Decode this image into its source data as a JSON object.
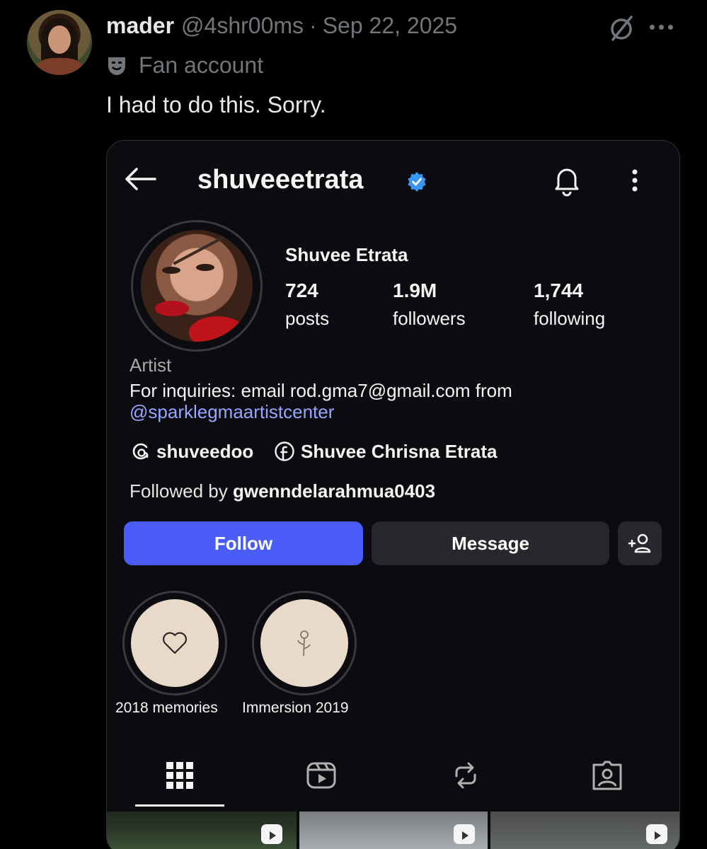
{
  "tweet": {
    "display_name": "mader",
    "handle": "@4shr00ms",
    "separator": "·",
    "date": "Sep 22, 2025",
    "label": "Fan account",
    "text": "I had to do this. Sorry."
  },
  "instagram": {
    "username": "shuveeetrata",
    "full_name": "Shuvee Etrata",
    "stats": [
      {
        "value": "724",
        "label": "posts"
      },
      {
        "value": "1.9M",
        "label": "followers"
      },
      {
        "value": "1,744",
        "label": "following"
      }
    ],
    "bio": {
      "category": "Artist",
      "line": "For inquiries: email rod.gma7@gmail.com from",
      "mention": "@sparklegmaartistcenter"
    },
    "links": {
      "threads": "shuveedoo",
      "facebook": "Shuvee Chrisna Etrata"
    },
    "followed_by_prefix": "Followed by ",
    "followed_by_user": "gwenndelarahmua0403",
    "buttons": {
      "follow": "Follow",
      "message": "Message"
    },
    "highlights": [
      {
        "label": "2018 memories",
        "icon": "heart-icon"
      },
      {
        "label": "Immersion 2019",
        "icon": "rose-icon"
      }
    ],
    "tabs": [
      "grid-icon",
      "reels-icon",
      "reposts-icon",
      "tagged-icon"
    ]
  },
  "colors": {
    "follow_button": "#4a5df9",
    "mention_link": "#94a6ff",
    "verified_badge": "#3897f0",
    "secondary_text": "#71767b"
  }
}
